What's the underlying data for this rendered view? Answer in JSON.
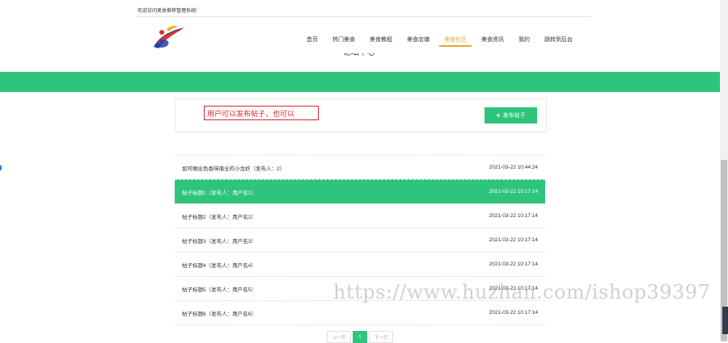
{
  "header": {
    "welcome_text": "欢迎访问美食推荐管理系统!",
    "nav": [
      {
        "label": "首页",
        "active": false
      },
      {
        "label": "热门美食",
        "active": false
      },
      {
        "label": "美食教程",
        "active": false
      },
      {
        "label": "美食店铺",
        "active": false
      },
      {
        "label": "美食社区",
        "active": true
      },
      {
        "label": "美食资讯",
        "active": false
      },
      {
        "label": "我的",
        "active": false
      },
      {
        "label": "跳转到后台",
        "active": false
      }
    ]
  },
  "page": {
    "cut_title": "论坛中心"
  },
  "composer": {
    "hint_text": "用户可以发布帖子，也可以",
    "publish_label": "发布帖子"
  },
  "posts": [
    {
      "title": "如何做出色香味俱全的小龙虾（发布人：2）",
      "time": "2021-03-22 10:44:24",
      "active": false
    },
    {
      "title": "帖子标题1（发布人：用户名1）",
      "time": "2021-03-22 10:17:14",
      "active": true
    },
    {
      "title": "帖子标题2（发布人：用户名2）",
      "time": "2021-03-22 10:17:14",
      "active": false
    },
    {
      "title": "帖子标题3（发布人：用户名3）",
      "time": "2021-03-22 10:17:14",
      "active": false
    },
    {
      "title": "帖子标题4（发布人：用户名4）",
      "time": "2021-03-22 10:17:14",
      "active": false
    },
    {
      "title": "帖子标题5（发布人：用户名5）",
      "time": "2021-03-22 10:17:14",
      "active": false
    },
    {
      "title": "帖子标题6（发布人：用户名6）",
      "time": "2021-03-22 10:17:14",
      "active": false
    }
  ],
  "pagination": {
    "prev_label": "上一页",
    "current": "1",
    "next_label": "下一页"
  },
  "watermark": "https://www.huzhan.com/ishop39397",
  "colors": {
    "accent": "#2ec47c",
    "nav_active": "#e5a42d",
    "hint_red": "#d9262c"
  }
}
